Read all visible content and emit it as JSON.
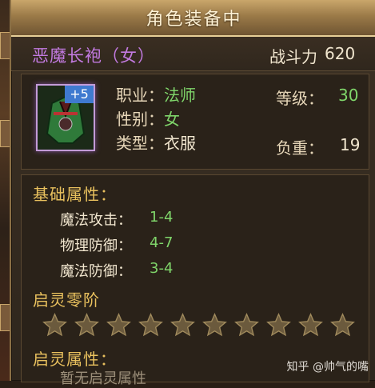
{
  "window": {
    "title": "角色装备中"
  },
  "item": {
    "name": "恶魔长袍（女）",
    "power_label": "战斗力",
    "power_value": "620",
    "enhance": "+5",
    "job_label": "职业：",
    "job_value": "法师",
    "gender_label": "性别：",
    "gender_value": "女",
    "type_label": "类型：",
    "type_value": "衣服",
    "level_label": "等级：",
    "level_value": "30",
    "weight_label": "负重：",
    "weight_value": "19"
  },
  "base_attrs": {
    "title": "基础属性：",
    "rows": [
      {
        "label": "魔法攻击：",
        "value": "1-4"
      },
      {
        "label": "物理防御：",
        "value": "4-7"
      },
      {
        "label": "魔法防御：",
        "value": "3-4"
      }
    ]
  },
  "spirit": {
    "tier_title": "启灵零阶",
    "stars_filled": 0,
    "stars_total": 10,
    "attr_title": "启灵属性：",
    "empty_text": "暂无启灵属性"
  },
  "watermark": "知乎 @帅气的嘴"
}
